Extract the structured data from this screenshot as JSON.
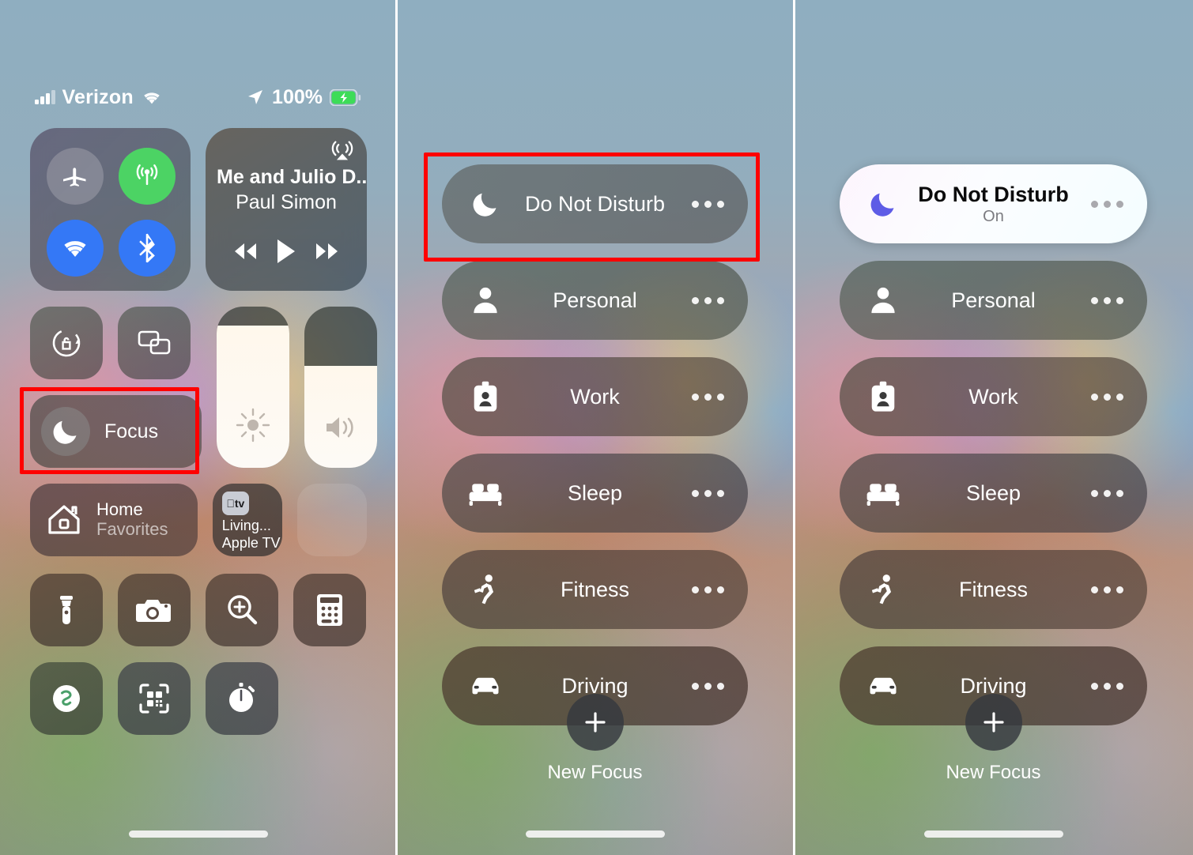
{
  "statusbar": {
    "carrier": "Verizon",
    "battery_percent": "100%",
    "signal_icon": "cellular-bars-icon",
    "wifi_icon": "wifi-icon",
    "location_icon": "location-arrow-icon",
    "battery_icon": "battery-charging-icon"
  },
  "panel1": {
    "connectivity": {
      "airplane": {
        "name": "Airplane Mode",
        "state": "off",
        "color": "#a0a0aa"
      },
      "cellular": {
        "name": "Cellular Data",
        "state": "on",
        "color": "#4cd364"
      },
      "wifi": {
        "name": "Wi-Fi",
        "state": "on",
        "color": "#3478f6"
      },
      "bluetooth": {
        "name": "Bluetooth",
        "state": "on",
        "color": "#3478f6"
      }
    },
    "media": {
      "track": "Me and Julio D...",
      "artist": "Paul Simon",
      "airplay_icon": "airplay-audio-icon",
      "rewind_icon": "rewind-icon",
      "play_icon": "play-icon",
      "forward_icon": "fast-forward-icon"
    },
    "orientation_lock_icon": "rotation-lock-icon",
    "screen_mirroring_icon": "screen-mirroring-icon",
    "focus_button": {
      "label": "Focus",
      "icon": "moon-icon"
    },
    "brightness": {
      "label": "Brightness",
      "icon": "sun-icon",
      "value_percent": 88
    },
    "volume": {
      "label": "Volume",
      "icon": "speaker-icon",
      "value_percent": 63
    },
    "home_tile": {
      "title": "Home",
      "subtitle": "Favorites",
      "icon": "house-icon"
    },
    "tv_tile": {
      "chip": "tv",
      "line1": "Living...",
      "line2": "Apple TV"
    },
    "apps_row1": [
      {
        "name": "Flashlight",
        "icon": "flashlight-icon"
      },
      {
        "name": "Camera",
        "icon": "camera-icon"
      },
      {
        "name": "Magnifier",
        "icon": "magnifier-icon"
      },
      {
        "name": "Calculator",
        "icon": "calculator-icon"
      }
    ],
    "apps_row2": [
      {
        "name": "Shazam",
        "icon": "shazam-icon"
      },
      {
        "name": "Code Scanner",
        "icon": "qr-code-scanner-icon"
      },
      {
        "name": "Timer",
        "icon": "timer-icon"
      }
    ]
  },
  "panel2": {
    "focus_modes": [
      {
        "label": "Do Not Disturb",
        "sub": "",
        "icon": "moon-icon",
        "state": "off",
        "highlighted": true
      },
      {
        "label": "Personal",
        "sub": "",
        "icon": "person-icon",
        "state": "off",
        "highlighted": false
      },
      {
        "label": "Work",
        "sub": "",
        "icon": "id-badge-icon",
        "state": "off",
        "highlighted": false
      },
      {
        "label": "Sleep",
        "sub": "",
        "icon": "bed-icon",
        "state": "off",
        "highlighted": false
      },
      {
        "label": "Fitness",
        "sub": "",
        "icon": "running-person-icon",
        "state": "off",
        "highlighted": false
      },
      {
        "label": "Driving",
        "sub": "",
        "icon": "car-icon",
        "state": "off",
        "highlighted": false
      }
    ],
    "new_focus": {
      "label": "New Focus",
      "icon": "plus-icon"
    }
  },
  "panel3": {
    "focus_modes": [
      {
        "label": "Do Not Disturb",
        "sub": "On",
        "icon": "moon-icon",
        "state": "on",
        "highlighted": false
      },
      {
        "label": "Personal",
        "sub": "",
        "icon": "person-icon",
        "state": "off",
        "highlighted": false
      },
      {
        "label": "Work",
        "sub": "",
        "icon": "id-badge-icon",
        "state": "off",
        "highlighted": false
      },
      {
        "label": "Sleep",
        "sub": "",
        "icon": "bed-icon",
        "state": "off",
        "highlighted": false
      },
      {
        "label": "Fitness",
        "sub": "",
        "icon": "running-person-icon",
        "state": "off",
        "highlighted": false
      },
      {
        "label": "Driving",
        "sub": "",
        "icon": "car-icon",
        "state": "off",
        "highlighted": false
      }
    ],
    "new_focus": {
      "label": "New Focus",
      "icon": "plus-icon"
    }
  },
  "annotations": {
    "color": "#ff0000",
    "boxes": [
      "focus-button-highlight",
      "do-not-disturb-highlight"
    ]
  },
  "colors": {
    "active_moon": "#5E5CE6",
    "cellular_green": "#4cd364",
    "blue": "#3478f6",
    "annotation_red": "#ff0000"
  }
}
